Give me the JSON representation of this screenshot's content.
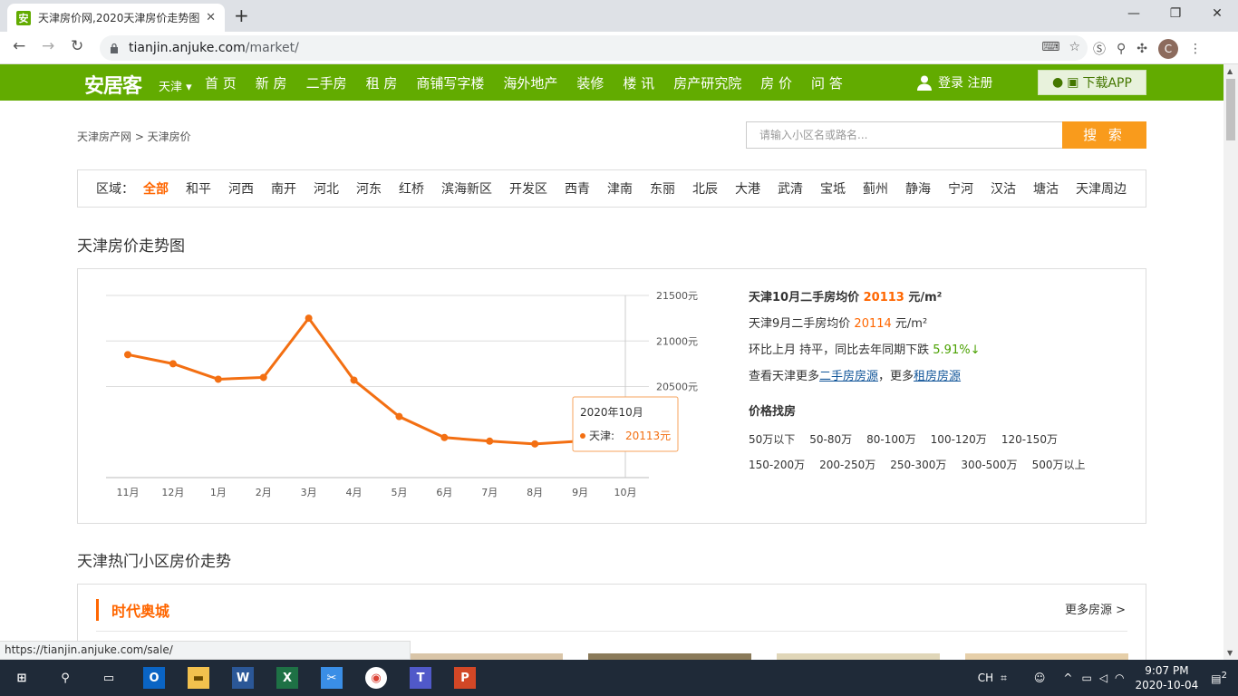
{
  "browser": {
    "tab_title": "天津房价网,2020天津房价走势图",
    "url_host": "tianjin.anjuke.com",
    "url_path": "/market/",
    "status_url": "https://tianjin.anjuke.com/sale/",
    "avatar_letter": "C"
  },
  "site": {
    "logo": "安居客",
    "city": "天津",
    "nav": [
      "首 页",
      "新 房",
      "二手房",
      "租 房",
      "商铺写字楼",
      "海外地产",
      "装修",
      "楼 讯",
      "房产研究院",
      "房 价",
      "问 答"
    ],
    "login": "登录 注册",
    "app_button": "下载APP"
  },
  "breadcrumb": "天津房产网 > 天津房价",
  "search": {
    "placeholder": "请输入小区名或路名...",
    "button": "搜 索"
  },
  "regions": {
    "label": "区域：",
    "items": [
      "全部",
      "和平",
      "河西",
      "南开",
      "河北",
      "河东",
      "红桥",
      "滨海新区",
      "开发区",
      "西青",
      "津南",
      "东丽",
      "北辰",
      "大港",
      "武清",
      "宝坻",
      "蓟州",
      "静海",
      "宁河",
      "汉沽",
      "塘沽",
      "天津周边"
    ],
    "active": 0
  },
  "trend_title": "天津房价走势图",
  "chart_data": {
    "type": "line",
    "categories": [
      "11月",
      "12月",
      "1月",
      "2月",
      "3月",
      "4月",
      "5月",
      "6月",
      "7月",
      "8月",
      "9月",
      "10月"
    ],
    "series": [
      {
        "name": "天津",
        "values": [
          20850,
          20750,
          20580,
          20600,
          21250,
          20570,
          20170,
          19940,
          19900,
          19870,
          19900,
          19900
        ]
      }
    ],
    "y_ticks": [
      "21500元",
      "21000元",
      "20500元"
    ],
    "ylim": [
      19500,
      21500
    ],
    "color": "#f36f12",
    "tooltip": {
      "title": "2020年10月",
      "series": "天津:",
      "value": "20113元"
    }
  },
  "info": {
    "line1_prefix": "天津10月二手房均价",
    "line1_value": "20113",
    "line1_unit": "元/m²",
    "line2_prefix": "天津9月二手房均价",
    "line2_value": "20114",
    "line2_unit": "元/m²",
    "line3_prefix": "环比上月 持平，同比去年同期下跌",
    "line3_value": "5.91%",
    "line3_arrow": "↓",
    "line4_prefix": "查看天津更多",
    "line4_link1": "二手房房源",
    "line4_mid": "，更多",
    "line4_link2": "租房房源",
    "price_title": "价格找房",
    "price_ranges": [
      "50万以下",
      "50-80万",
      "80-100万",
      "100-120万",
      "120-150万",
      "150-200万",
      "200-250万",
      "250-300万",
      "300-500万",
      "500万以上"
    ]
  },
  "hot_title": "天津热门小区房价走势",
  "community": {
    "name": "时代奥城",
    "more": "更多房源 >"
  },
  "taskbar": {
    "lang": "CH",
    "time": "9:07 PM",
    "date": "2020-10-04",
    "notify": "2"
  }
}
